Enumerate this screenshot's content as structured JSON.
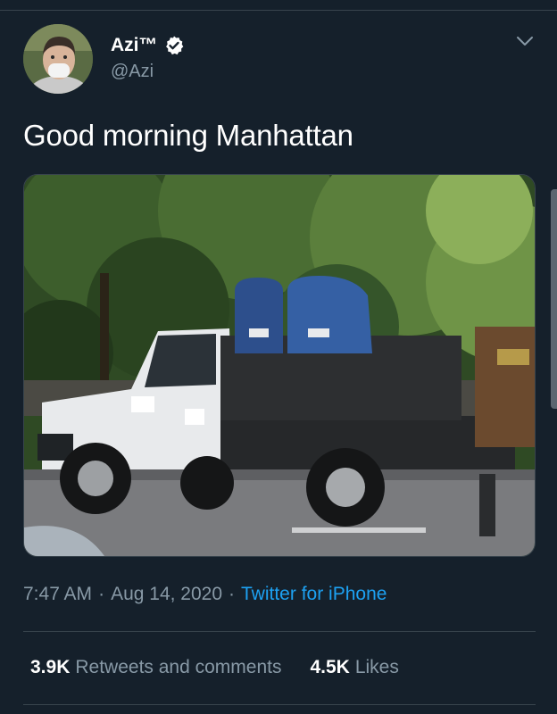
{
  "tweet": {
    "author": {
      "display_name": "Azi™",
      "handle": "@Azi",
      "verified": true,
      "avatar_icon": "profile-photo-masked-person"
    },
    "text": "Good morning Manhattan",
    "media": {
      "alt_icon": "photo-usps-mailboxes-on-truck"
    },
    "meta": {
      "time": "7:47 AM",
      "separator": "·",
      "date": "Aug 14, 2020",
      "source": "Twitter for iPhone"
    },
    "stats": {
      "retweets_count": "3.9K",
      "retweets_label": "Retweets and comments",
      "likes_count": "4.5K",
      "likes_label": "Likes"
    }
  },
  "colors": {
    "background": "#15202b",
    "divider": "#38444d",
    "secondary_text": "#8899a6",
    "link": "#1da1f2",
    "verified_badge": "#ffffff"
  }
}
